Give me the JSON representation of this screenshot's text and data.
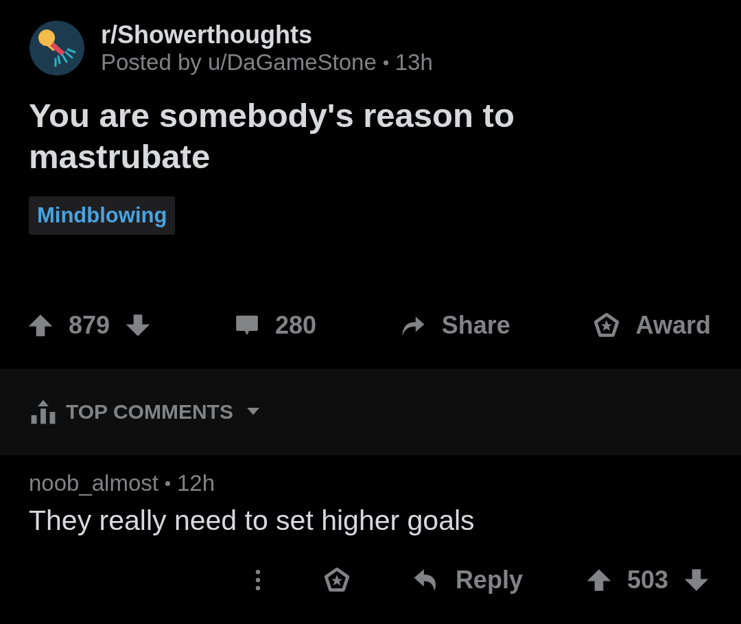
{
  "post": {
    "subreddit": "r/Showerthoughts",
    "posted_by": "Posted by u/DaGameStone",
    "age": "13h",
    "title": "You are somebody's reason to mastrubate",
    "flair": "Mindblowing"
  },
  "actions": {
    "score": "879",
    "comments": "280",
    "share": "Share",
    "award": "Award"
  },
  "sort": {
    "label": "TOP COMMENTS"
  },
  "comments": [
    {
      "author": "noob_almost",
      "age": "12h",
      "body": "They really need to set higher goals",
      "reply": "Reply",
      "score": "503"
    }
  ]
}
